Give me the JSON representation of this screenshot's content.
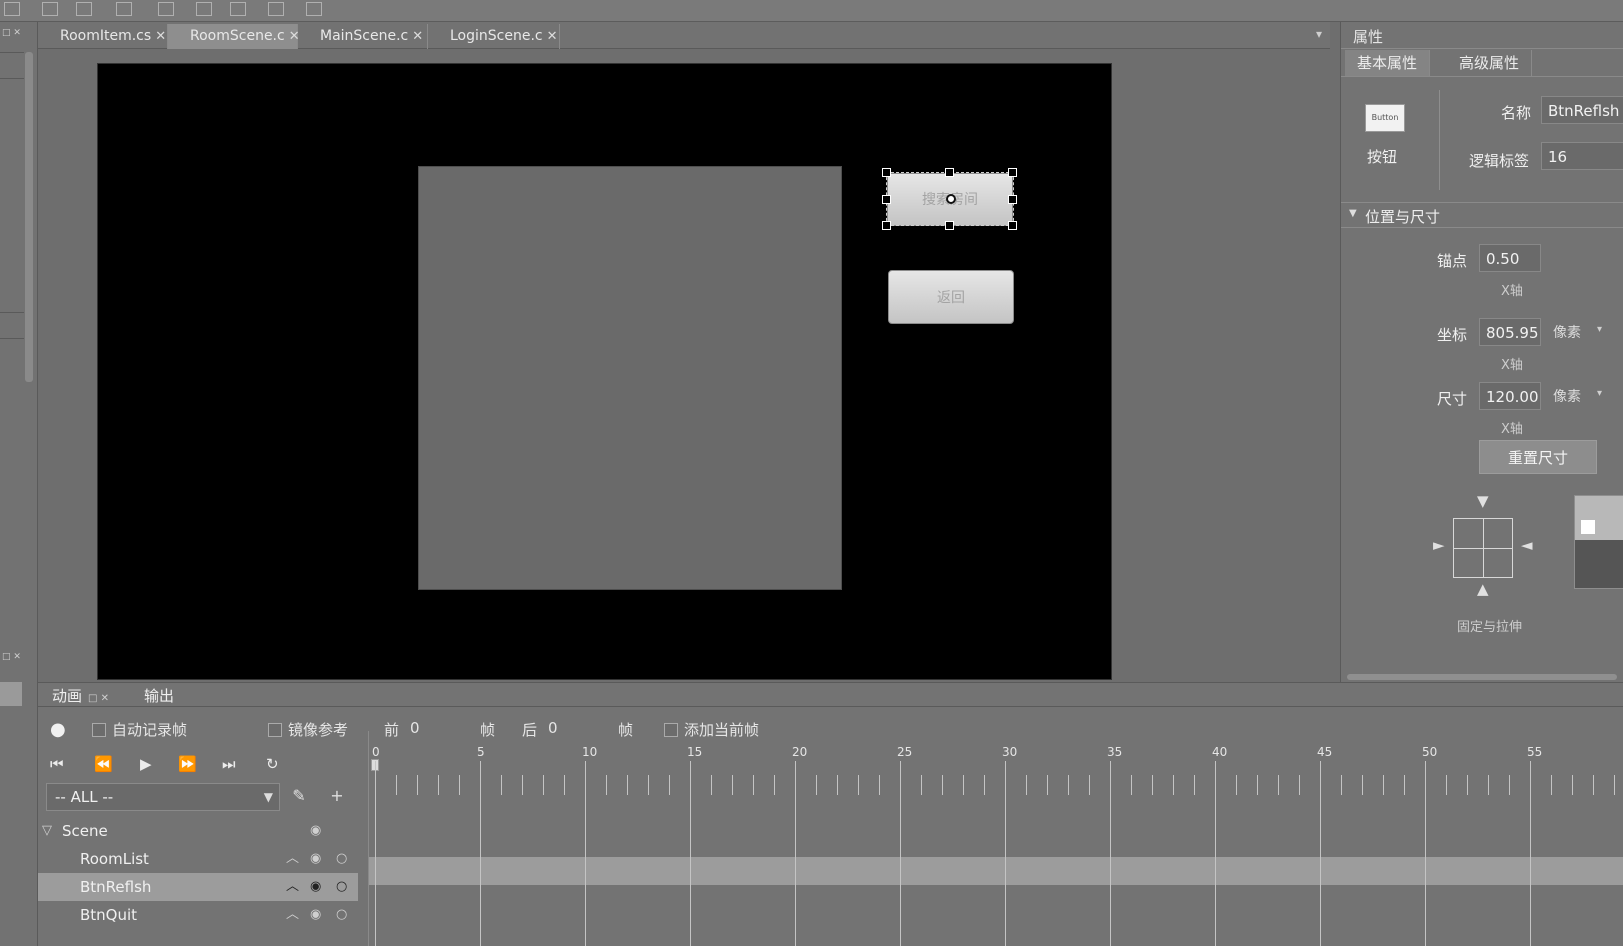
{
  "document_tabs": [
    {
      "label": "RoomItem.cs",
      "active": false
    },
    {
      "label": "RoomScene.c",
      "active": true
    },
    {
      "label": "MainScene.c",
      "active": false
    },
    {
      "label": "LoginScene.c",
      "active": false
    }
  ],
  "canvas": {
    "refresh_button_text": "搜索房间",
    "quit_button_text": "返回"
  },
  "properties": {
    "panel_title": "属性",
    "tab_basic": "基本属性",
    "tab_advanced": "高级属性",
    "widget_thumb": "Button",
    "widget_type": "按钮",
    "name_label": "名称",
    "name_value": "BtnReflsh",
    "tag_label": "逻辑标签",
    "tag_value": "16",
    "section_title": "位置与尺寸",
    "anchor_label": "锚点",
    "anchor_value": "0.50",
    "axis_x": "X轴",
    "position_label": "坐标",
    "position_value": "805.95",
    "size_label": "尺寸",
    "size_value": "120.00",
    "unit": "像素",
    "reset_size": "重置尺寸",
    "pin_stretch": "固定与拉伸"
  },
  "animation": {
    "tab_animation": "动画",
    "tab_output": "输出",
    "auto_record": "自动记录帧",
    "mirror_ref": "镜像参考",
    "before_label": "前",
    "before_value": "0",
    "frame_label": "帧",
    "after_label": "后",
    "after_value": "0",
    "add_current_frame": "添加当前帧",
    "filter_value": "-- ALL --",
    "tree": [
      {
        "label": "Scene",
        "level": 0,
        "selected": false
      },
      {
        "label": "RoomList",
        "level": 1,
        "selected": false
      },
      {
        "label": "BtnReflsh",
        "level": 1,
        "selected": true
      },
      {
        "label": "BtnQuit",
        "level": 1,
        "selected": false
      }
    ],
    "timeline_labels": [
      "0",
      "5",
      "10",
      "15",
      "20",
      "25",
      "30",
      "35",
      "40",
      "45",
      "50",
      "55"
    ]
  },
  "icons": {
    "close": "close-icon",
    "first_frame": "first-frame-icon",
    "prev_frame": "prev-frame-icon",
    "play": "play-icon",
    "next_frame": "next-frame-icon",
    "last_frame": "last-frame-icon",
    "loop": "loop-icon",
    "edit": "pencil-icon",
    "add": "plus-icon",
    "eye": "eye-icon",
    "lock": "lock-icon"
  }
}
